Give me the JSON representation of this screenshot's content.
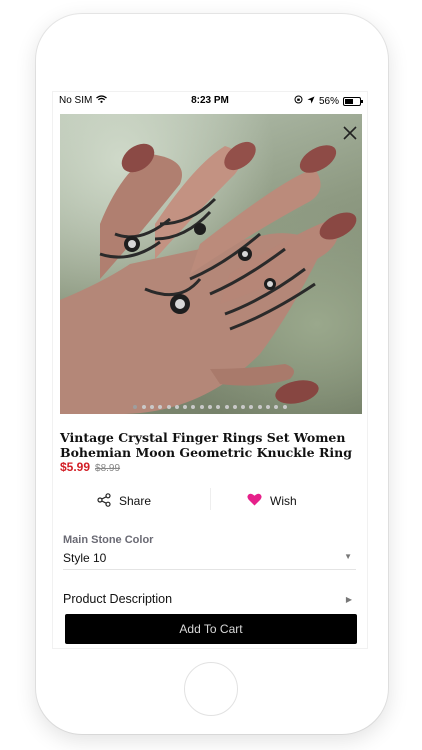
{
  "status": {
    "carrier": "No SIM",
    "time": "8:23 PM",
    "battery_text": "56%",
    "battery_level": 0.56
  },
  "product": {
    "image_alt": "hand wearing silver knuckle rings",
    "image_count": 19,
    "active_index": 0,
    "title": "Vintage Crystal Finger Rings Set Women Bohemian Moon Geometric Knuckle Ring",
    "price": "$5.99",
    "old_price": "$8.99"
  },
  "actions": {
    "share_label": "Share",
    "wish_label": "Wish"
  },
  "option": {
    "label": "Main Stone Color",
    "selected": "Style 10"
  },
  "description": {
    "label": "Product Description"
  },
  "cart": {
    "label": "Add To Cart"
  },
  "colors": {
    "price": "#d21f26",
    "wish_heart": "#e6208a",
    "cart_button": "#000000"
  },
  "icons": [
    "wifi-icon",
    "orientation-lock-icon",
    "location-arrow-icon",
    "battery-icon",
    "close-icon",
    "share-icon",
    "heart-icon",
    "caret-down-icon",
    "caret-right-icon"
  ]
}
